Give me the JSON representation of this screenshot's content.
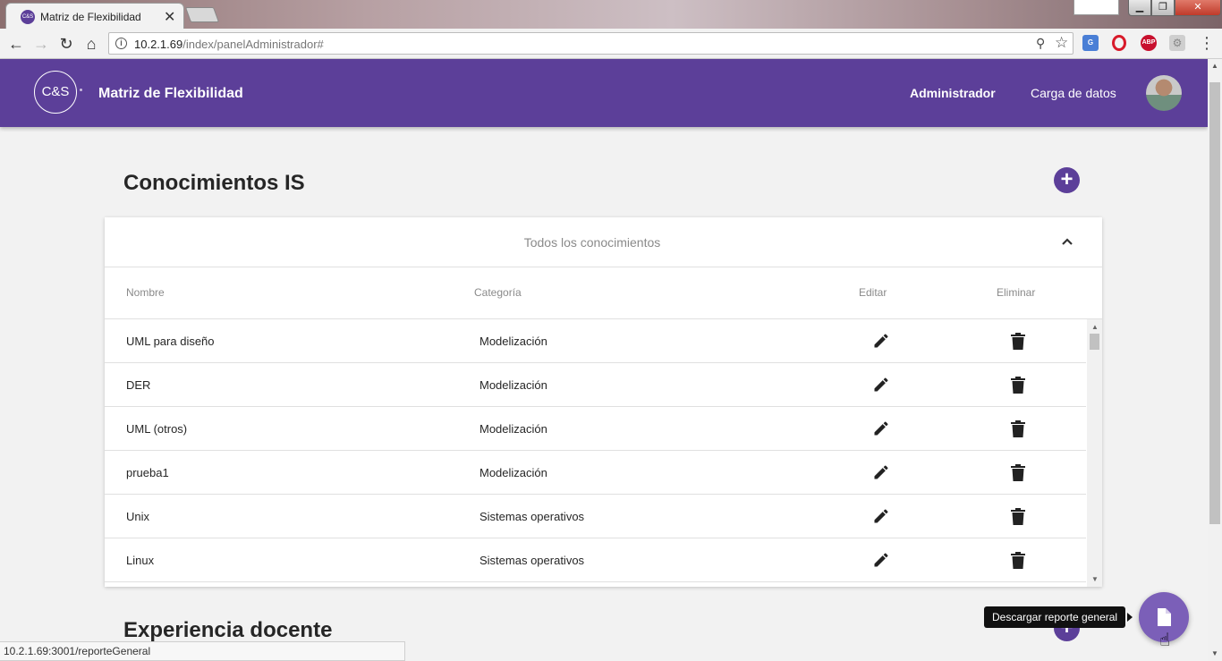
{
  "browser": {
    "tab_title": "Matriz de Flexibilidad",
    "favicon_text": "C&S",
    "tab_close": "✕",
    "url_host": "10.2.1.69",
    "url_path": "/index/panelAdministrador#",
    "status_url": "10.2.1.69:3001/reporteGeneral",
    "window_close": "✕",
    "window_min": "▁",
    "window_max": "❐"
  },
  "header": {
    "logo_text": "C&S",
    "title": "Matriz de Flexibilidad",
    "nav_admin": "Administrador",
    "nav_carga": "Carga de datos",
    "brand_color": "#5c3f99"
  },
  "section1": {
    "title": "Conocimientos IS",
    "add_label": "+",
    "card_title": "Todos los conocimientos",
    "columns": {
      "nombre": "Nombre",
      "categoria": "Categoría",
      "editar": "Editar",
      "eliminar": "Eliminar"
    },
    "rows": [
      {
        "nombre": "UML para diseño",
        "categoria": "Modelización"
      },
      {
        "nombre": "DER",
        "categoria": "Modelización"
      },
      {
        "nombre": "UML (otros)",
        "categoria": "Modelización"
      },
      {
        "nombre": "prueba1",
        "categoria": "Modelización"
      },
      {
        "nombre": "Unix",
        "categoria": "Sistemas operativos"
      },
      {
        "nombre": "Linux",
        "categoria": "Sistemas operativos"
      }
    ]
  },
  "section2": {
    "title": "Experiencia docente",
    "add_label": "+"
  },
  "fab": {
    "tooltip": "Descargar reporte general",
    "icon": "document-icon"
  }
}
